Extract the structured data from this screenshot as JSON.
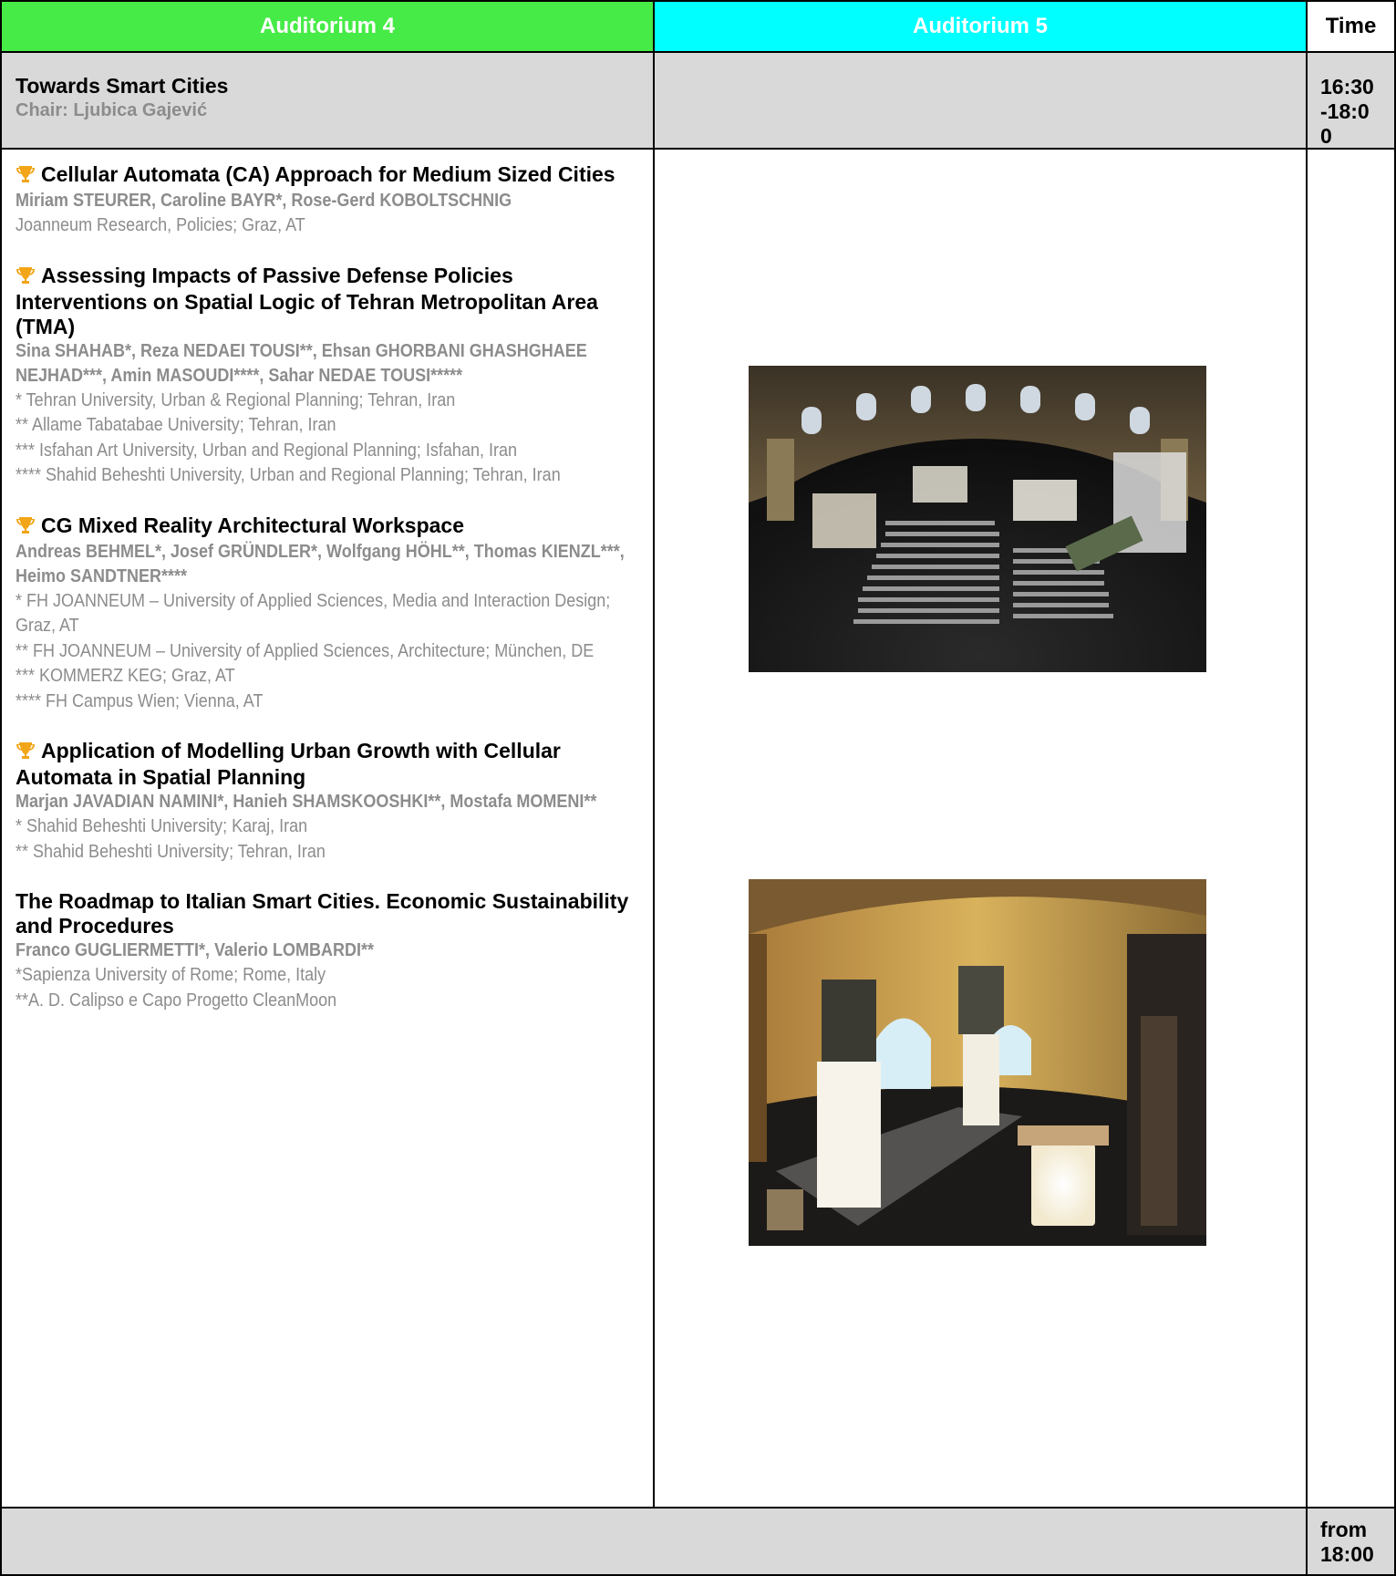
{
  "header": {
    "auditorium4": "Auditorium 4",
    "auditorium5": "Auditorium 5",
    "time": "Time"
  },
  "colors": {
    "auditorium4_header": "#47eb47",
    "auditorium5_header": "#00ffff",
    "session_band": "#d9d9d9",
    "muted_text": "#8c8c8c",
    "trophy": "#f2a516"
  },
  "session": {
    "title": "Towards Smart Cities",
    "chair": "Chair: Ljubica Gajević",
    "time": "16:30-18:00"
  },
  "papers": [
    {
      "award": true,
      "title": "Cellular Automata (CA) Approach for Medium Sized Cities",
      "authors": "Miriam STEURER, Caroline BAYR*, Rose-Gerd KOBOLTSCHNIG",
      "affiliations": [
        "Joanneum Research, Policies; Graz, AT"
      ]
    },
    {
      "award": true,
      "title": "Assessing Impacts of Passive Defense Policies Interventions on Spatial Logic of Tehran Metropolitan Area (TMA)",
      "authors": "Sina SHAHAB*, Reza NEDAEI TOUSI**, Ehsan GHORBANI GHASHGHAEE NEJHAD***, Amin MASOUDI****, Sahar NEDAE TOUSI*****",
      "affiliations": [
        "* Tehran University, Urban & Regional Planning; Tehran, Iran",
        "** Allame Tabatabae University; Tehran, Iran",
        "*** Isfahan Art University, Urban and Regional Planning; Isfahan, Iran",
        "**** Shahid Beheshti University, Urban and Regional Planning; Tehran, Iran"
      ]
    },
    {
      "award": true,
      "title": "CG Mixed Reality Architectural Workspace",
      "authors": "Andreas BEHMEL*, Josef GRÜNDLER*, Wolfgang HÖHL**, Thomas KIENZL***, Heimo SANDTNER****",
      "affiliations": [
        "* FH JOANNEUM – University of Applied Sciences, Media and Interaction Design; Graz, AT",
        "** FH JOANNEUM – University of Applied Sciences, Architecture; München, DE",
        "*** KOMMERZ KEG; Graz, AT",
        "**** FH Campus Wien; Vienna, AT"
      ]
    },
    {
      "award": true,
      "title": "Application of Modelling Urban Growth with Cellular Automata in Spatial Planning",
      "authors": "Marjan JAVADIAN NAMINI*, Hanieh SHAMSKOOSHKI**, Mostafa MOMENI**",
      "affiliations": [
        "* Shahid Beheshti University; Karaj, Iran",
        "** Shahid Beheshti University; Tehran, Iran"
      ]
    },
    {
      "award": false,
      "title": "The Roadmap to Italian Smart Cities. Economic Sustainability and Procedures",
      "authors": "Franco GUGLIERMETTI*, Valerio LOMBARDI**",
      "affiliations": [
        "*Sapienza University of Rome; Rome, Italy",
        "**A. D. Calipso e Capo Progetto CleanMoon"
      ]
    }
  ],
  "footer": {
    "time": "from 18:00"
  },
  "icons": {
    "award": "trophy-icon"
  }
}
